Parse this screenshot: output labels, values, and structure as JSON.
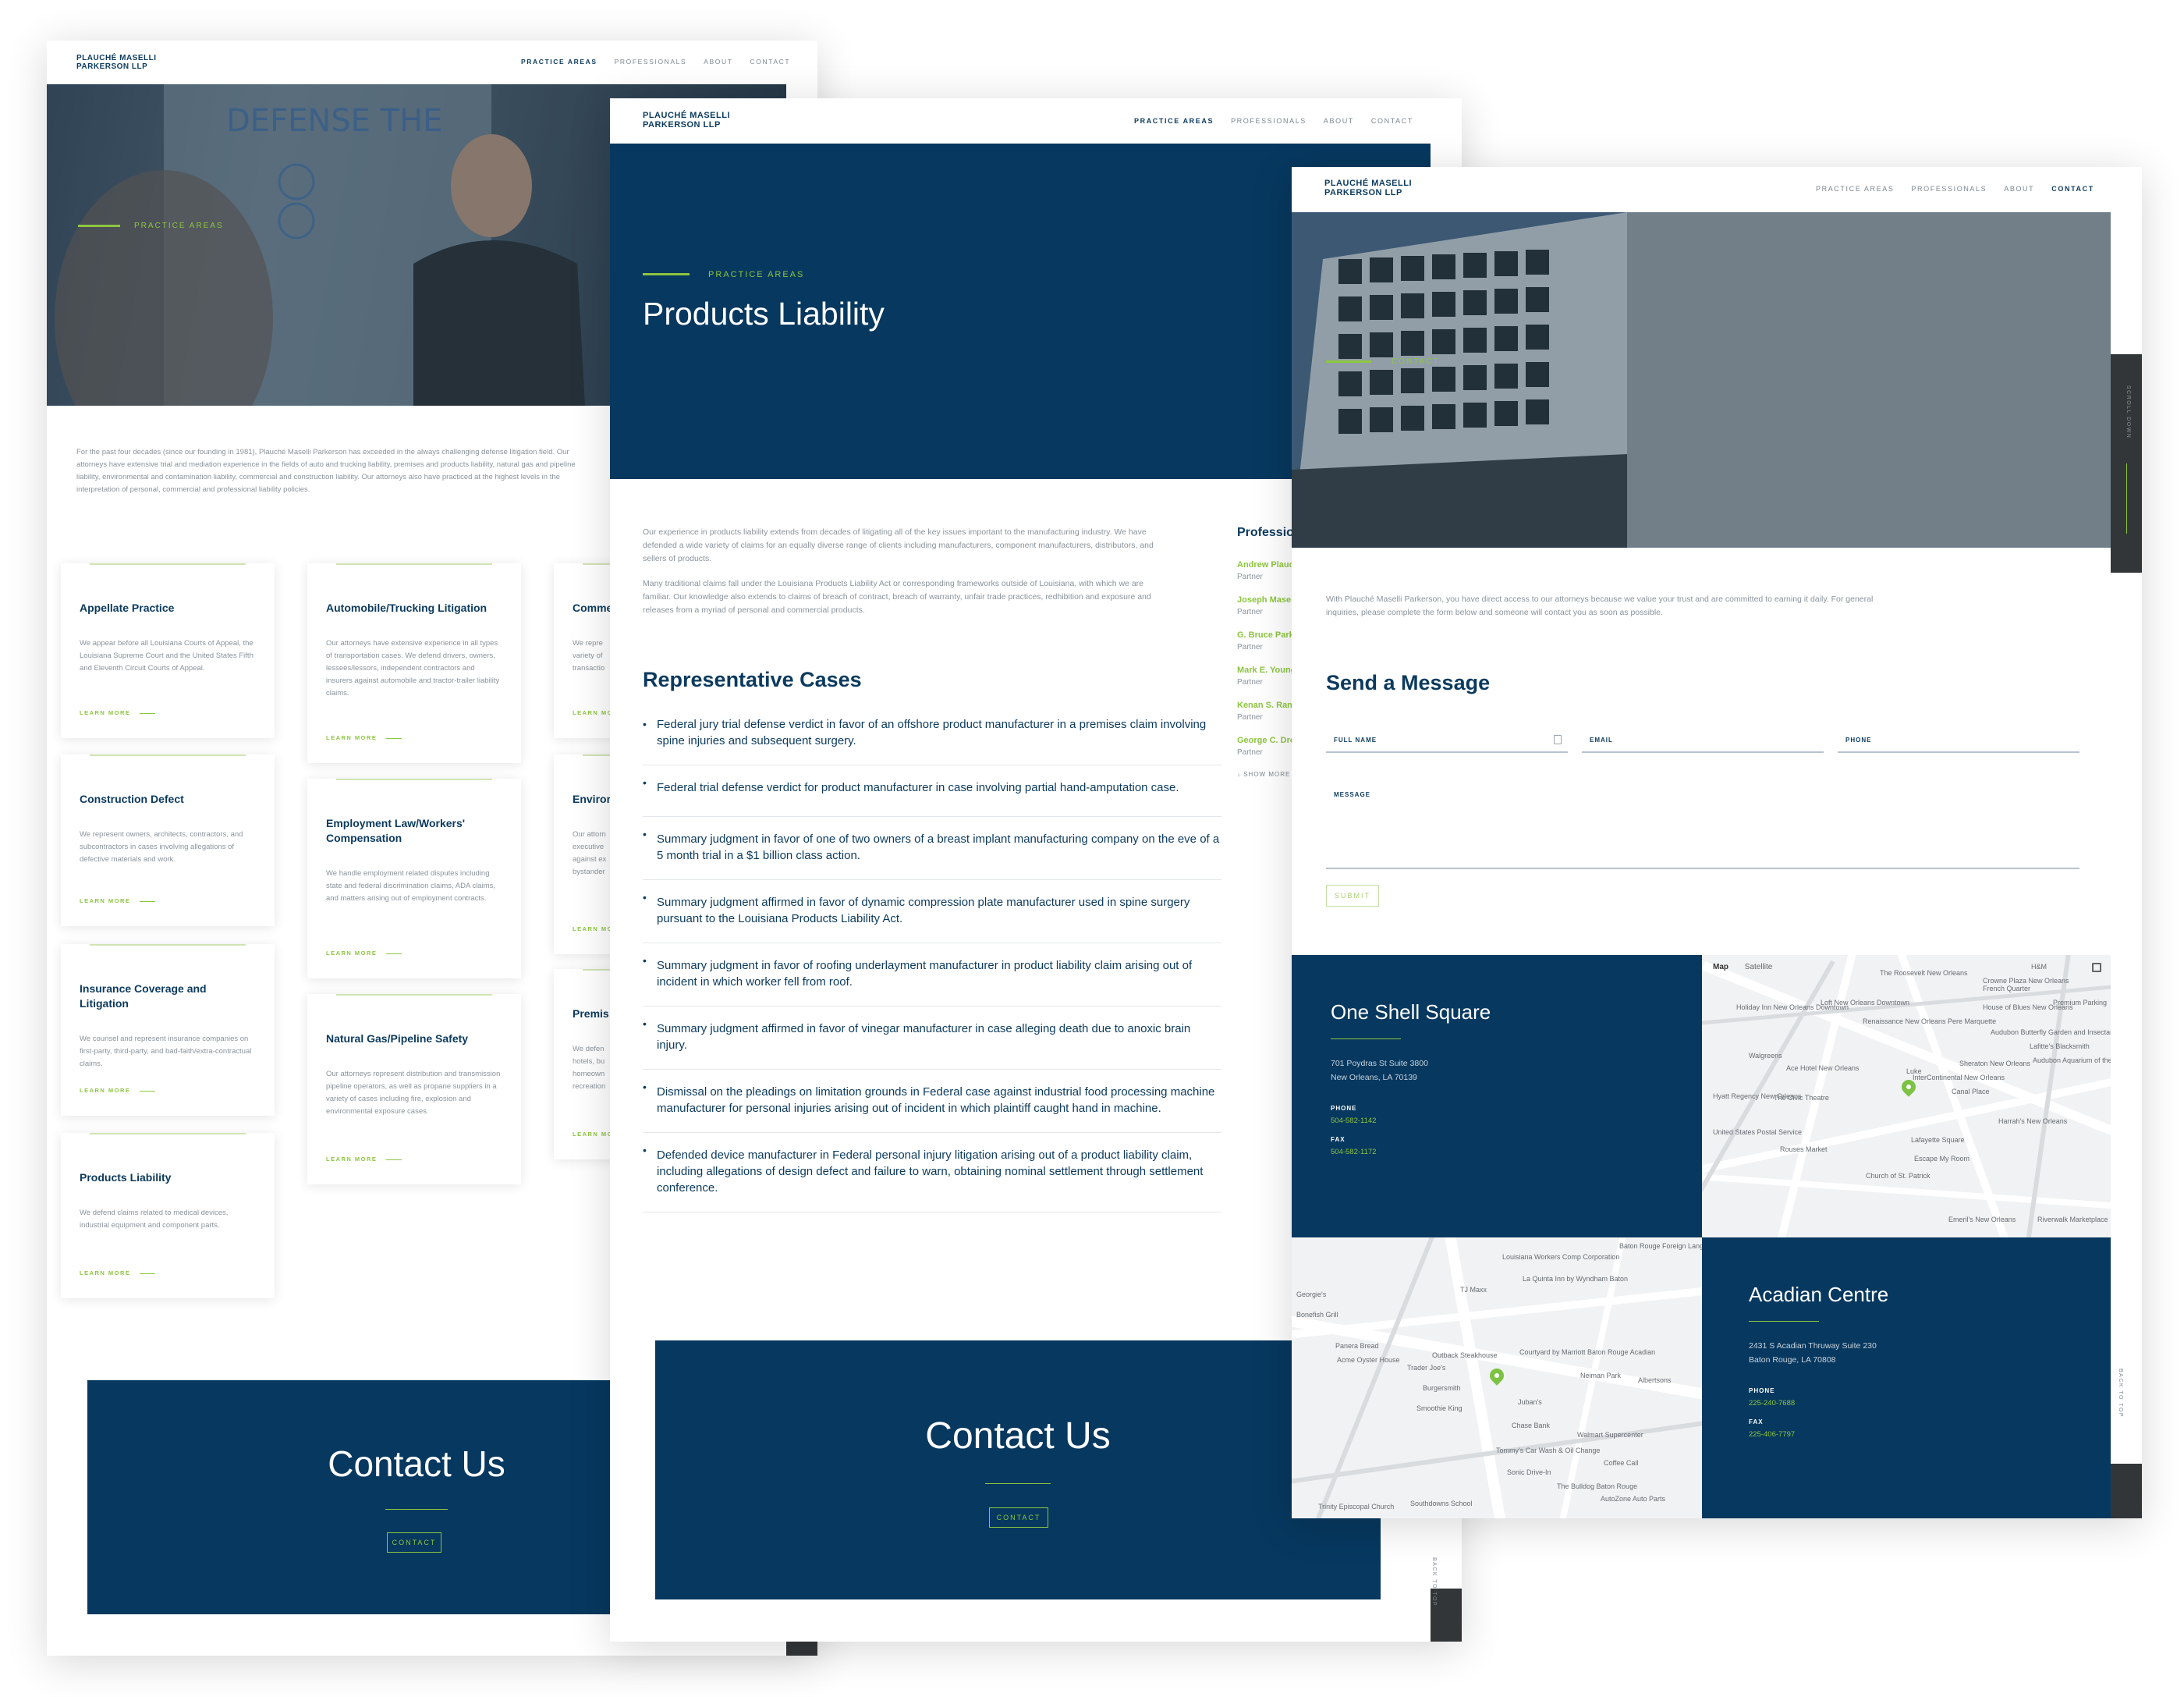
{
  "brand": {
    "line1": "PLAUCHÉ MASELLI",
    "line2": "PARKERSON LLP"
  },
  "nav": {
    "practice": "PRACTICE AREAS",
    "professionals": "PROFESSIONALS",
    "about": "ABOUT",
    "contact": "CONTACT"
  },
  "page1": {
    "eyebrow": "PRACTICE AREAS",
    "intro": "For the past four decades (since our founding in 1981), Plauché Maselli Parkerson has exceeded in the always challenging defense litigation field. Our attorneys have extensive trial and mediation experience in the fields of auto and trucking liability, premises and products liability, natural gas and pipeline liability, environmental and contamination liability, commercial and construction liability. Our attorneys also have practiced at the highest levels in the interpretation of personal, commercial and professional liability policies.",
    "learn_more": "LEARN MORE",
    "col1": [
      {
        "title": "Appellate Practice",
        "desc": "We appear before all Louisiana Courts of Appeal, the Louisiana Supreme Court and the United States Fifth and Eleventh Circuit Courts of Appeal."
      },
      {
        "title": "Construction Defect",
        "desc": "We represent owners, architects, contractors, and subcontractors in cases involving allegations of defective materials and work."
      },
      {
        "title": "Insurance Coverage and Litigation",
        "desc": "We counsel and represent insurance companies on first-party, third-party, and bad-faith/extra-contractual claims."
      },
      {
        "title": "Products Liability",
        "desc": "We defend claims related to medical devices, industrial equipment and component parts."
      }
    ],
    "col2": [
      {
        "title": "Automobile/Trucking Litigation",
        "desc": "Our attorneys have extensive experience in all types of transportation cases. We defend drivers, owners, lessees/lessors, independent contractors and insurers against automobile and tractor-trailer liability claims."
      },
      {
        "title": "Employment Law/Workers' Compensation",
        "desc": "We handle employment related disputes including state and federal discrimination claims, ADA claims, and matters arising out of employment contracts."
      },
      {
        "title": "Natural Gas/Pipeline Safety",
        "desc": "Our attorneys represent distribution and transmission pipeline operators, as well as propane suppliers in a variety of cases including fire, explosion and environmental exposure cases."
      }
    ],
    "col3": [
      {
        "title": "Comme",
        "desc": "We repre variety of transactio"
      },
      {
        "title": "Environ",
        "desc": "Our attorn executive against ex bystander"
      },
      {
        "title": "Premis",
        "desc": "We defen hotels, bu homeown recreation"
      }
    ],
    "contact_title": "Contact Us",
    "contact_btn": "CONTACT"
  },
  "page2": {
    "eyebrow": "PRACTICE AREAS",
    "title": "Products Liability",
    "p1": "Our experience in products liability extends from decades of litigating all of the key issues important to the manufacturing industry. We have defended a wide variety of claims for an equally diverse range of clients including manufacturers, component manufacturers, distributors, and sellers of products.",
    "p2": "Many traditional claims fall under the Louisiana Products Liability Act or corresponding frameworks outside of Louisiana, with which we are familiar. Our knowledge also extends to claims of breach of contract, breach of warranty, unfair trade practices, redhibition and exposure and releases from a myriad of personal and commercial products.",
    "cases_title": "Representative Cases",
    "cases": [
      "Federal jury trial defense verdict in favor of an offshore product manufacturer in a premises claim involving spine injuries and subsequent surgery.",
      "Federal trial defense verdict for product manufacturer in case involving partial hand-amputation case.",
      "Summary judgment in favor of one of two owners of a breast implant manufacturing company on the eve of a 5 month trial in a $1 billion class action.",
      "Summary judgment affirmed in favor of dynamic compression plate manufacturer used in spine surgery pursuant to the Louisiana Products Liability Act.",
      "Summary judgment in favor of roofing underlayment manufacturer in product liability claim arising out of incident in which worker fell from roof.",
      "Summary judgment affirmed in favor of vinegar manufacturer in case alleging death due to anoxic brain injury.",
      "Dismissal on the pleadings on limitation grounds in Federal case against industrial food processing machine manufacturer for personal injuries arising out of incident in which plaintiff caught hand in machine.",
      "Defended device manufacturer in Federal personal injury litigation arising out of a product liability claim, including allegations of design defect and failure to warn, obtaining nominal settlement through settlement conference."
    ],
    "prof_title": "Profession",
    "professionals": [
      {
        "name": "Andrew Plauc",
        "role": "Partner"
      },
      {
        "name": "Joseph Masell",
        "role": "Partner"
      },
      {
        "name": "G. Bruce Park",
        "role": "Partner"
      },
      {
        "name": "Mark E. Young",
        "role": "Partner"
      },
      {
        "name": "Kenan S. Rand",
        "role": "Partner"
      },
      {
        "name": "George C. Dre",
        "role": "Partner"
      }
    ],
    "show_more": "↓ SHOW MORE",
    "contact_title": "Contact Us",
    "contact_btn": "CONTACT",
    "back_to_top": "BACK TO TOP"
  },
  "page3": {
    "eyebrow": "CONTACT",
    "scroll_down": "SCROLL DOWN",
    "back_to_top": "BACK TO TOP",
    "intro": "With Plauché Maselli Parkerson, you have direct access to our attorneys because we value your trust and are committed to earning it daily. For general inquiries, please complete the form below and someone will contact you as soon as possible.",
    "form_title": "Send a Message",
    "fields": {
      "name": "FULL NAME",
      "email": "EMAIL",
      "phone": "PHONE",
      "message": "MESSAGE"
    },
    "submit": "SUBMIT",
    "office1": {
      "name": "One Shell Square",
      "addr1": "701 Poydras St Suite 3800",
      "addr2": "New Orleans, LA 70139",
      "phone_label": "PHONE",
      "phone": "504-582-1142",
      "fax_label": "FAX",
      "fax": "504-582-1172"
    },
    "office2": {
      "name": "Acadian Centre",
      "addr1": "2431 S Acadian Thruway Suite 230",
      "addr2": "Baton Rouge, LA 70808",
      "phone_label": "PHONE",
      "phone": "225-240-7688",
      "fax_label": "FAX",
      "fax": "225-406-7797"
    },
    "map1": {
      "tab_map": "Map",
      "tab_sat": "Satellite",
      "labels": [
        "The Roosevelt New Orleans",
        "Crowne Plaza New Orleans French Quarter",
        "Holiday Inn New Orleans Downtown",
        "Loft New Orleans Downtown",
        "House of Blues New Orleans",
        "Renaissance New Orleans Pere Marquette",
        "Audubon Butterfly Garden and Insectarium",
        "Lafitte's Blacksmith",
        "Ace Hotel New Orleans",
        "Harrah's New Orleans",
        "Lafayette Square",
        "Church of St. Patrick",
        "Emeril's New Orleans",
        "Riverwalk Marketplace",
        "Premium Parking",
        "The Civic Theatre",
        "Hyatt Regency New Orleans",
        "United States Postal Service",
        "Rouses Market",
        "Escape My Room",
        "Sheraton New Orleans",
        "Canal Place",
        "InterContinental New Orleans",
        "Audubon Aquarium of the Americas",
        "Luke",
        "Walgreens",
        "H&M"
      ]
    },
    "map2": {
      "labels": [
        "Louisiana Workers Comp Corporation",
        "La Quinta Inn by Wyndham Baton",
        "TJ Maxx",
        "Baton Rouge Foreign Language",
        "Outback Steakhouse",
        "Courtyard by Marriott Baton Rouge Acadian",
        "Trader Joe's",
        "Burgersmith",
        "Smoothie King",
        "Juban's",
        "Chase Bank",
        "Walmart Supercenter",
        "Coffee Call",
        "Albertsons",
        "Neiman Park",
        "Tommy's Car Wash & Oil Change",
        "Sonic Drive-In",
        "The Bulldog Baton Rouge",
        "Trinity Episcopal Church",
        "Southdowns School",
        "AutoZone Auto Parts",
        "Panera Bread",
        "Acme Oyster House",
        "Georgie's",
        "Bonefish Grill"
      ]
    }
  },
  "colors": {
    "navy": "#07385f",
    "green": "#8dc63f",
    "gray_text": "#8a939b",
    "dark_bar": "#333638"
  }
}
